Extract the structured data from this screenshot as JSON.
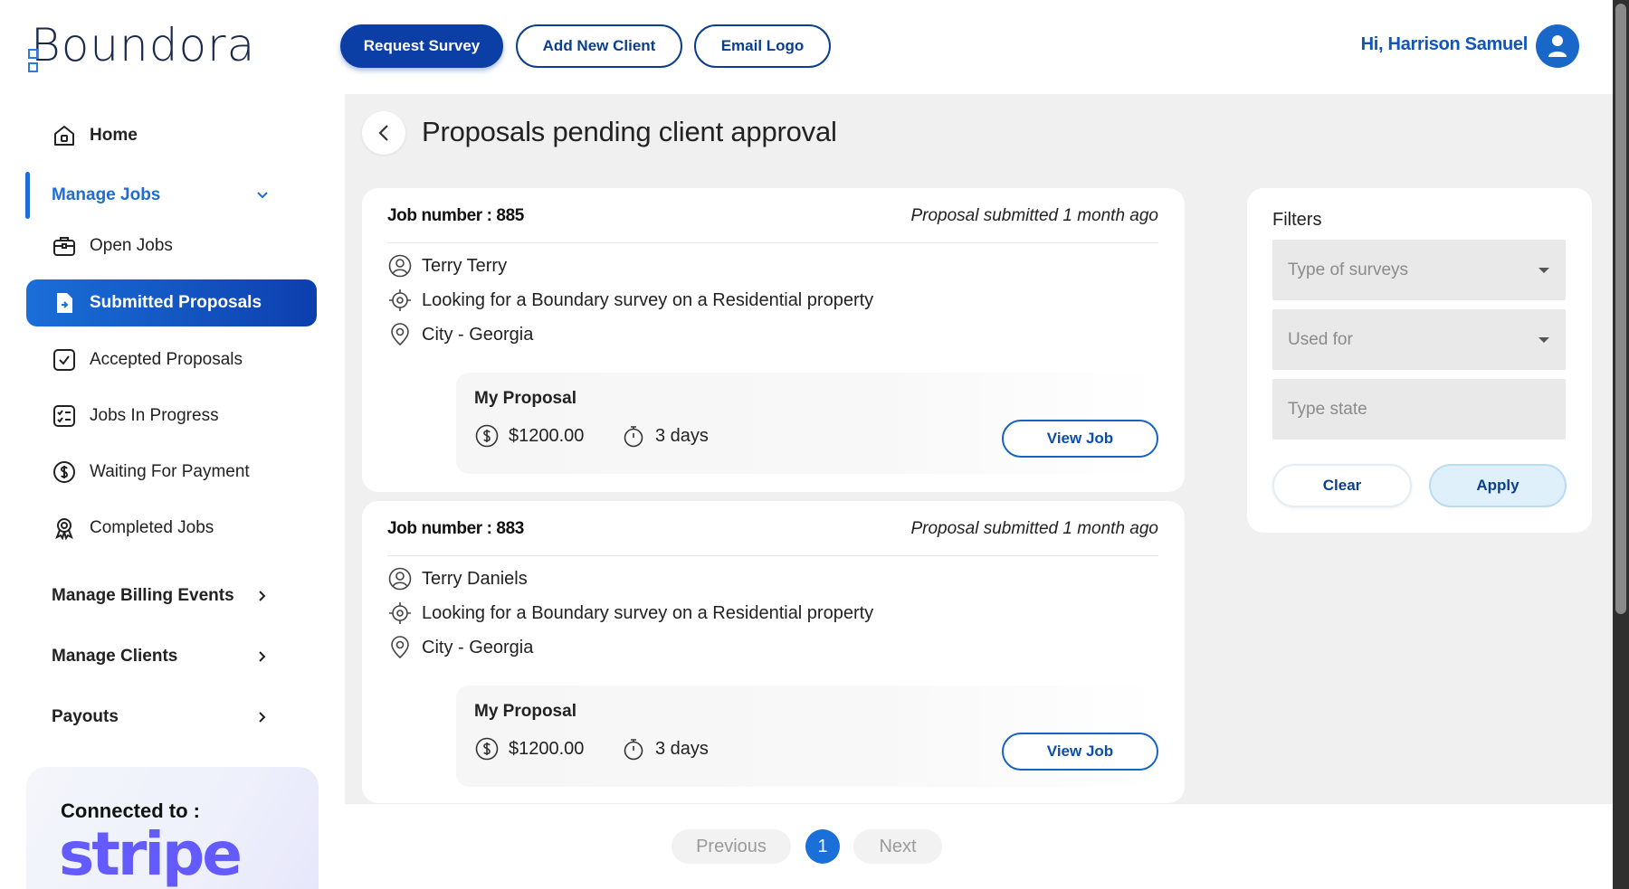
{
  "app": {
    "logo_text": "Boundora"
  },
  "header": {
    "request_survey": "Request Survey",
    "add_new_client": "Add New Client",
    "email_logo": "Email Logo",
    "greeting": "Hi, Harrison Samuel"
  },
  "sidebar": {
    "home": "Home",
    "manage_jobs": "Manage Jobs",
    "items": [
      {
        "label": "Open Jobs",
        "icon": "briefcase-icon"
      },
      {
        "label": "Submitted Proposals",
        "icon": "document-icon"
      },
      {
        "label": "Accepted Proposals",
        "icon": "checkbox-icon"
      },
      {
        "label": "Jobs In Progress",
        "icon": "checklist-icon"
      },
      {
        "label": "Waiting For Payment",
        "icon": "dollar-icon"
      },
      {
        "label": "Completed Jobs",
        "icon": "award-icon"
      }
    ],
    "sections": [
      {
        "label": "Manage Billing Events"
      },
      {
        "label": "Manage Clients"
      },
      {
        "label": "Payouts"
      }
    ],
    "connected_label": "Connected to :",
    "stripe_logo": "stripe"
  },
  "main": {
    "title": "Proposals pending client approval",
    "jobs": [
      {
        "job_number": "Job number : 885",
        "submitted": "Proposal submitted 1 month ago",
        "client": "Terry Terry",
        "request": "Looking for a Boundary survey on a Residential property",
        "location": "City - Georgia",
        "proposal_title": "My Proposal",
        "price": "$1200.00",
        "duration": "3 days",
        "view_label": "View Job"
      },
      {
        "job_number": "Job number : 883",
        "submitted": "Proposal submitted 1 month ago",
        "client": "Terry Daniels",
        "request": "Looking for a Boundary survey on a Residential property",
        "location": "City - Georgia",
        "proposal_title": "My Proposal",
        "price": "$1200.00",
        "duration": "3 days",
        "view_label": "View Job"
      }
    ]
  },
  "filters": {
    "title": "Filters",
    "type_of_surveys": "Type of surveys",
    "used_for": "Used for",
    "type_state": "Type state",
    "clear": "Clear",
    "apply": "Apply"
  },
  "pagination": {
    "previous": "Previous",
    "current": "1",
    "next": "Next"
  },
  "colors": {
    "primary": "#0b3fa6",
    "accent": "#1a6fd8",
    "stripe": "#635bff"
  }
}
